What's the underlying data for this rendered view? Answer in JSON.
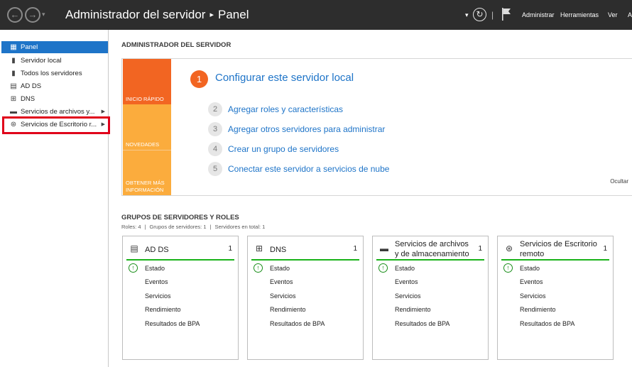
{
  "titlebar": {
    "app": "Administrador del servidor",
    "separator": "▸",
    "page": "Panel",
    "back_glyph": "←",
    "forward_glyph": "→",
    "dropdown_glyph": "▾",
    "refresh_glyph": "↻",
    "divider": "|",
    "menu": {
      "administrar": "Administrar",
      "herramientas": "Herramientas",
      "ver": "Ver",
      "ayuda": "A"
    }
  },
  "sidebar": {
    "items": [
      {
        "label": "Panel",
        "icon": "dashboard-icon",
        "glyph": "▦"
      },
      {
        "label": "Servidor local",
        "icon": "server-icon",
        "glyph": "▮"
      },
      {
        "label": "Todos los servidores",
        "icon": "servers-icon",
        "glyph": "▮"
      },
      {
        "label": "AD DS",
        "icon": "ad-ds-icon",
        "glyph": "▤"
      },
      {
        "label": "DNS",
        "icon": "dns-icon",
        "glyph": "⊞"
      },
      {
        "label": "Servicios de archivos y...",
        "icon": "file-services-icon",
        "glyph": "▬",
        "arrow": "▶"
      },
      {
        "label": "Servicios de Escritorio r...",
        "icon": "remote-desktop-icon",
        "glyph": "⊛",
        "arrow": "▶"
      }
    ]
  },
  "main": {
    "header": "ADMINISTRADOR DEL SERVIDOR",
    "quick_start": {
      "tiles": [
        "INICIO RÁPIDO",
        "NOVEDADES",
        "OBTENER MÁS INFORMACIÓN"
      ],
      "main_step": {
        "num": "1",
        "label": "Configurar este servidor local"
      },
      "steps": [
        {
          "num": "2",
          "label": "Agregar roles y características"
        },
        {
          "num": "3",
          "label": "Agregar otros servidores para administrar"
        },
        {
          "num": "4",
          "label": "Crear un grupo de servidores"
        },
        {
          "num": "5",
          "label": "Conectar este servidor a servicios de nube"
        }
      ],
      "hide": "Ocultar"
    },
    "groups": {
      "header": "GRUPOS DE SERVIDORES Y ROLES",
      "roles": "Roles: 4",
      "groups_count": "Grupos de servidores: 1",
      "total": "Servidores en total: 1",
      "divider": "|",
      "cards": [
        {
          "title": "AD DS",
          "count": "1",
          "icon": "ad-ds-icon",
          "glyph": "▤"
        },
        {
          "title": "DNS",
          "count": "1",
          "icon": "dns-icon",
          "glyph": "⊞"
        },
        {
          "title": "Servicios de archivos y de almacenamiento",
          "count": "1",
          "icon": "file-services-icon",
          "glyph": "▬"
        },
        {
          "title": "Servicios de Escritorio remoto",
          "count": "1",
          "icon": "remote-desktop-icon",
          "glyph": "⊛"
        }
      ],
      "status_glyph": "↑",
      "rows": [
        "Estado",
        "Eventos",
        "Servicios",
        "Rendimiento",
        "Resultados de BPA"
      ]
    }
  },
  "colors": {
    "accent": "#1e74c8",
    "orange": "#f26522",
    "amber": "#fbac3d",
    "ok_green": "#1ab31a",
    "highlight": "#e0001a"
  }
}
